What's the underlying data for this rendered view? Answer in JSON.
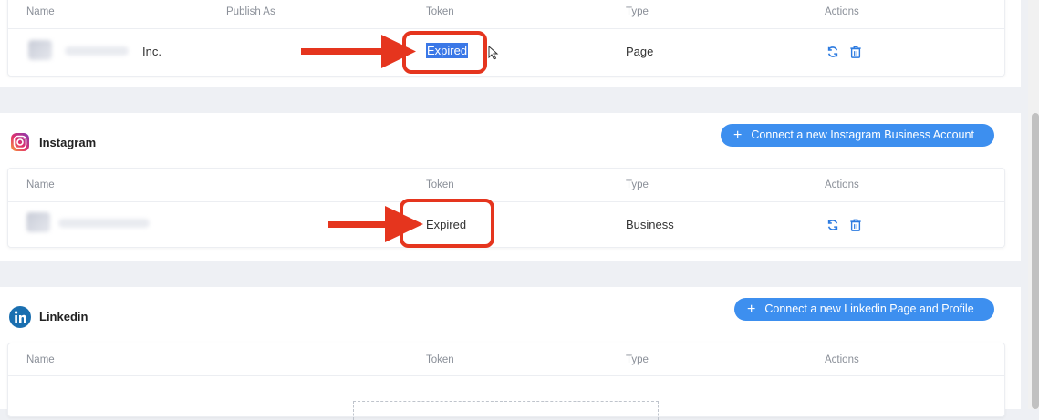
{
  "table_headers": {
    "name": "Name",
    "publish_as": "Publish As",
    "token": "Token",
    "type": "Type",
    "actions": "Actions"
  },
  "facebook_row": {
    "name_suffix": "Inc.",
    "token": "Expired",
    "type": "Page"
  },
  "instagram": {
    "title": "Instagram",
    "connect_label": "Connect a new Instagram Business Account",
    "row": {
      "token": "Expired",
      "type": "Business"
    }
  },
  "linkedin": {
    "title": "Linkedin",
    "connect_label": "Connect a new Linkedin Page and Profile"
  },
  "colors": {
    "accent": "#3d8fef",
    "annotation": "#e5351e",
    "selection": "#3b78e7"
  }
}
